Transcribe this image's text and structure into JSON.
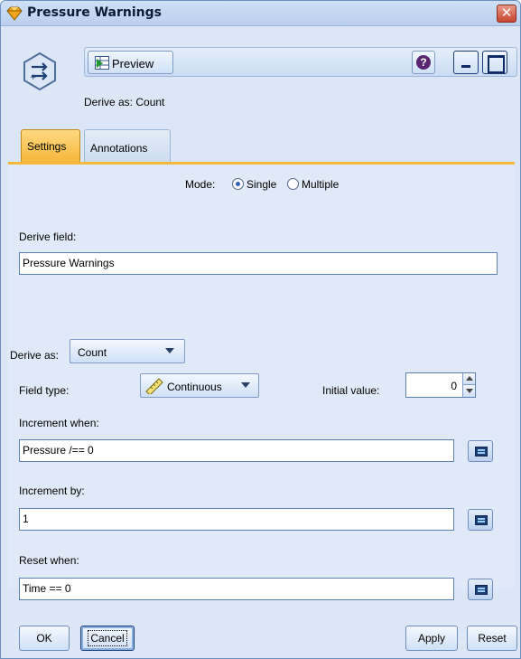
{
  "window": {
    "title": "Pressure Warnings"
  },
  "toolbar": {
    "preview_label": "Preview",
    "help_glyph": "?"
  },
  "header": {
    "derive_caption": "Derive as: Count"
  },
  "tabs": [
    {
      "label": "Settings",
      "active": true
    },
    {
      "label": "Annotations",
      "active": false
    }
  ],
  "settings": {
    "mode_label": "Mode:",
    "mode_options": [
      {
        "label": "Single",
        "selected": true
      },
      {
        "label": "Multiple",
        "selected": false
      }
    ],
    "derive_field_label": "Derive field:",
    "derive_field_value": "Pressure Warnings",
    "derive_as_label": "Derive as:",
    "derive_as_value": "Count",
    "field_type_label": "Field type:",
    "field_type_value": "Continuous",
    "initial_value_label": "Initial value:",
    "initial_value": "0",
    "increment_when_label": "Increment when:",
    "increment_when_value": "Pressure /== 0",
    "increment_by_label": "Increment by:",
    "increment_by_value": "1",
    "reset_when_label": "Reset when:",
    "reset_when_value": "Time == 0"
  },
  "footer": {
    "ok_label": "OK",
    "cancel_label": "Cancel",
    "apply_label": "Apply",
    "reset_label": "Reset"
  },
  "icons": {
    "title_icon": "diamond-node-icon",
    "node_icon": "derive-node-icon",
    "preview_icon": "preview-table-icon",
    "field_type_icon": "ruler-icon",
    "expression_builder_icon": "calculator-icon"
  },
  "colors": {
    "active_tab": "#f6b73c",
    "panel_bg": "#dfe9f7",
    "close_button": "#c8442c"
  }
}
